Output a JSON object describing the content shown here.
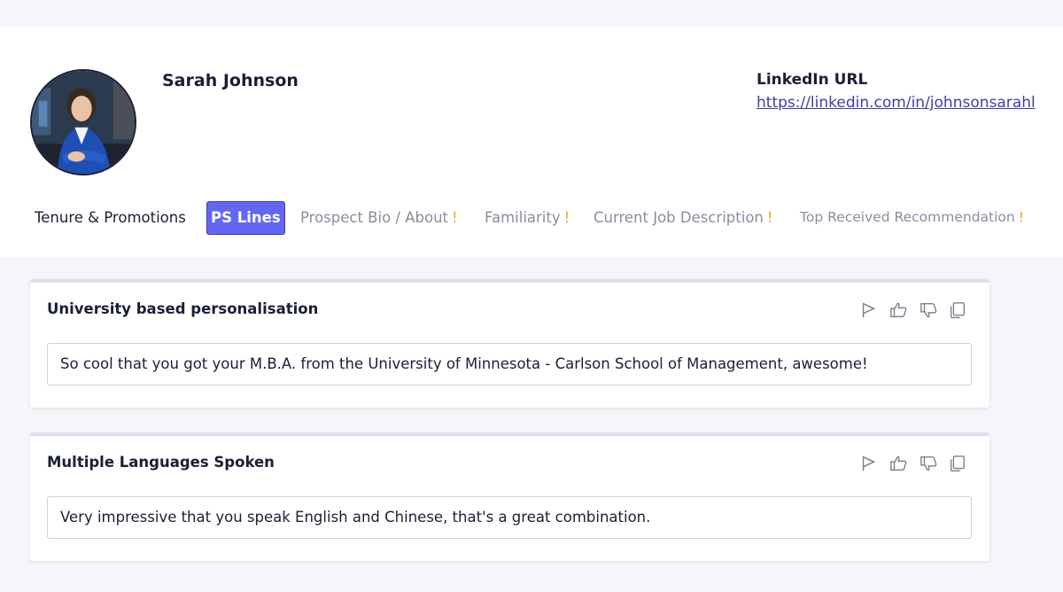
{
  "profile": {
    "name": "Sarah Johnson",
    "linkedin_label": "LinkedIn URL",
    "linkedin_url": "https://linkedin.com/in/johnsonsarahl"
  },
  "tabs": [
    {
      "label": "Tenure & Promotions",
      "state": "default",
      "warn": ""
    },
    {
      "label": "PS Lines",
      "state": "active",
      "warn": ""
    },
    {
      "label": "Prospect Bio / About",
      "state": "muted",
      "warn": "!"
    },
    {
      "label": "Familiarity",
      "state": "muted",
      "warn": "!"
    },
    {
      "label": "Current Job Description",
      "state": "muted",
      "warn": "!"
    },
    {
      "label": "Top Received Recommendation",
      "state": "muted",
      "warn": "!"
    }
  ],
  "cards": [
    {
      "title": "University based personalisation",
      "text": "So cool that you got your M.B.A. from the University of Minnesota - Carlson School of Management, awesome!"
    },
    {
      "title": "Multiple Languages Spoken",
      "text": "Very impressive that you speak English and Chinese, that's a great combination."
    }
  ],
  "card_actions": [
    "flag-icon",
    "thumbs-up-icon",
    "thumbs-down-icon",
    "copy-icon"
  ],
  "colors": {
    "accent": "#6366f1",
    "warning": "#f0a431",
    "link": "#3b3fa8"
  }
}
